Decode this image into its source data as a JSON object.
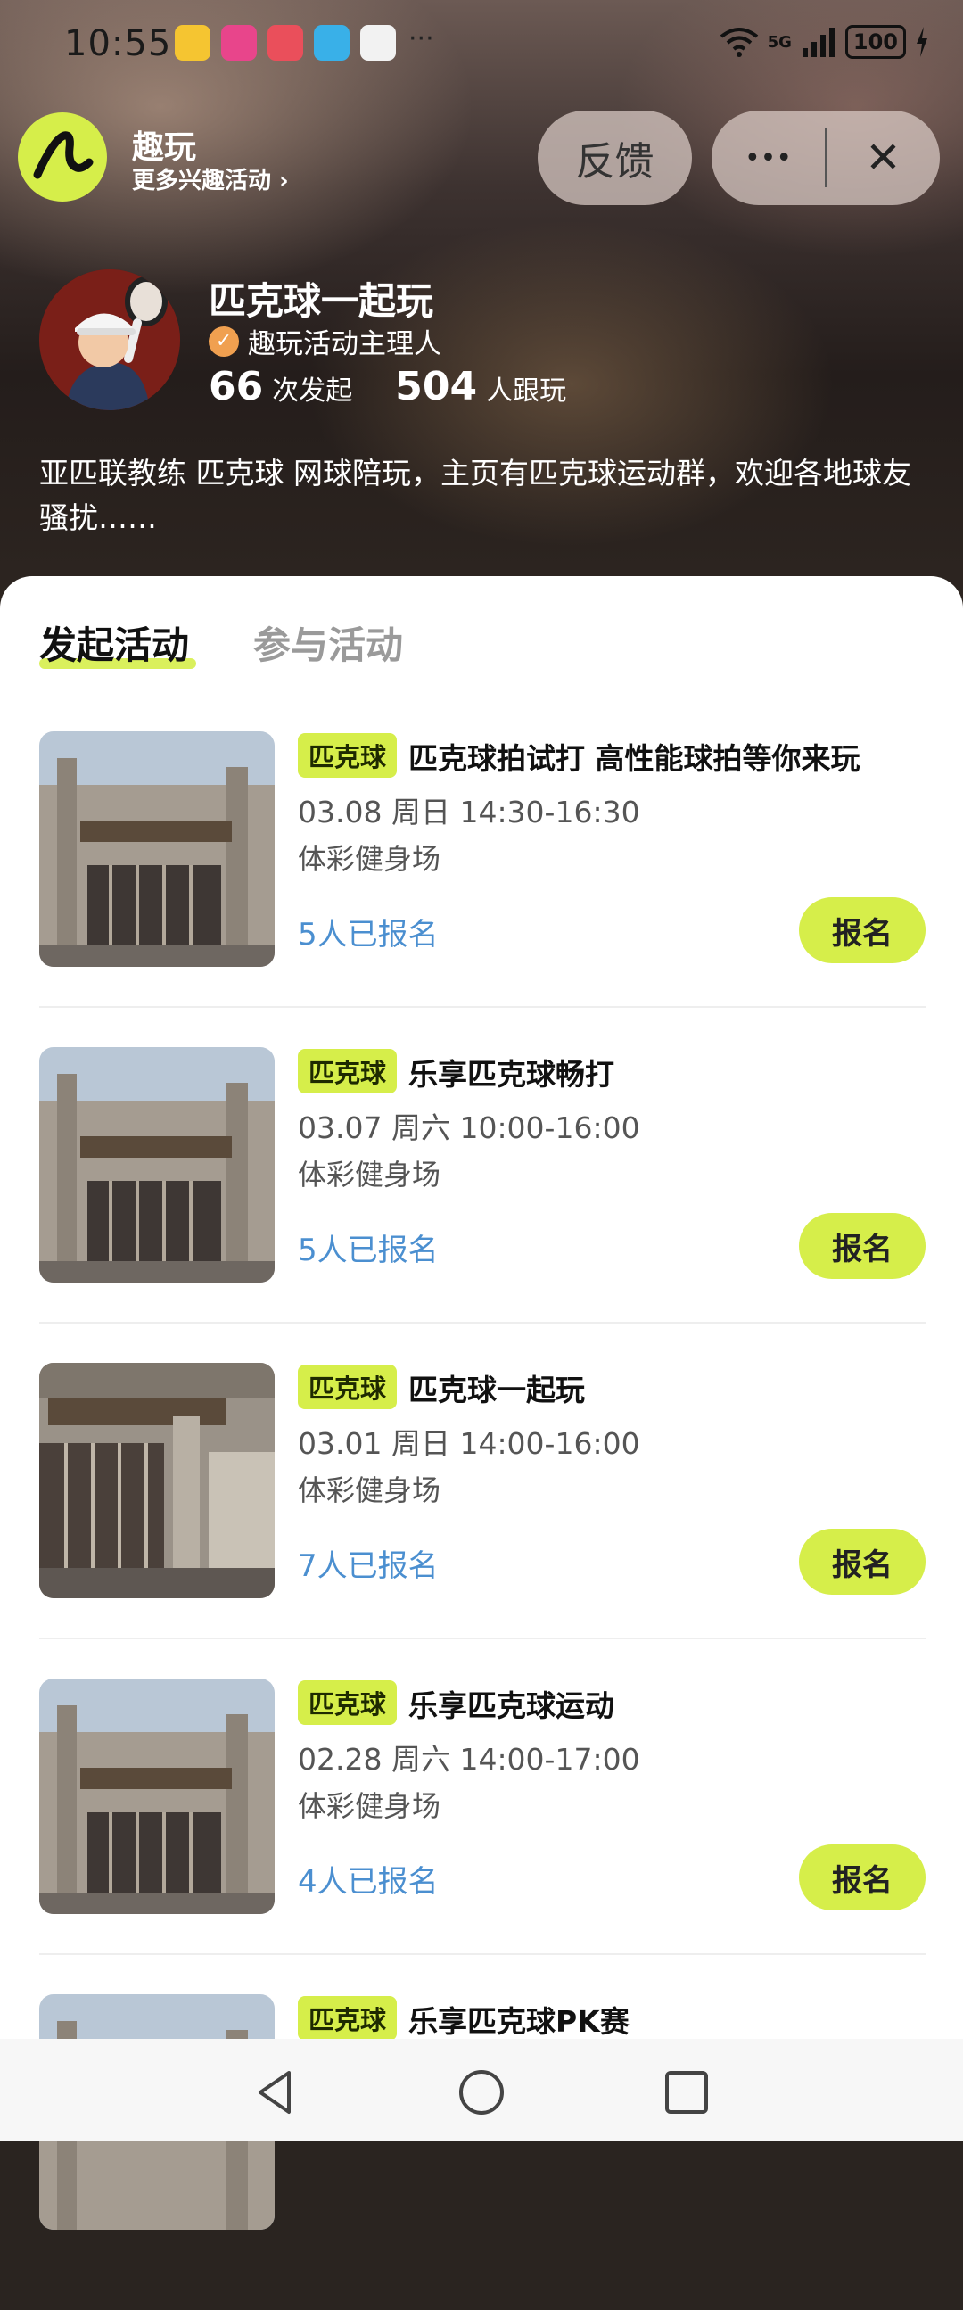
{
  "status_bar": {
    "time": "10:55",
    "more": "···",
    "network": "5G",
    "battery": "100"
  },
  "header": {
    "brand": "趣玩",
    "brand_sub": "更多兴趣活动 ›",
    "feedback_label": "反馈",
    "more_label": "•••",
    "close_label": "✕"
  },
  "profile": {
    "name": "匹克球一起玩",
    "role": "趣玩活动主理人",
    "launch_count": "66",
    "launch_label": "次发起",
    "follow_count": "504",
    "follow_label": "人跟玩",
    "bio": "亚匹联教练 匹克球 网球陪玩，主页有匹克球运动群，欢迎各地球友骚扰……"
  },
  "tabs": [
    {
      "label": "发起活动",
      "active": true
    },
    {
      "label": "参与活动",
      "active": false
    }
  ],
  "activities": [
    {
      "tag": "匹克球",
      "title": "匹克球拍试打 高性能球拍等你来玩",
      "time": "03.08 周日 14:30-16:30",
      "venue": "体彩健身场",
      "count": "5人已报名",
      "button": "报名"
    },
    {
      "tag": "匹克球",
      "title": "乐享匹克球畅打",
      "time": "03.07 周六 10:00-16:00",
      "venue": "体彩健身场",
      "count": "5人已报名",
      "button": "报名"
    },
    {
      "tag": "匹克球",
      "title": "匹克球一起玩",
      "time": "03.01 周日 14:00-16:00",
      "venue": "体彩健身场",
      "count": "7人已报名",
      "button": "报名"
    },
    {
      "tag": "匹克球",
      "title": "乐享匹克球运动",
      "time": "02.28 周六 14:00-17:00",
      "venue": "体彩健身场",
      "count": "4人已报名",
      "button": "报名"
    },
    {
      "tag": "匹克球",
      "title": "乐享匹克球PK赛",
      "time": "",
      "venue": "",
      "count": "",
      "button": ""
    }
  ],
  "colors": {
    "accent": "#d6ee4a",
    "link": "#4b8fd0"
  }
}
